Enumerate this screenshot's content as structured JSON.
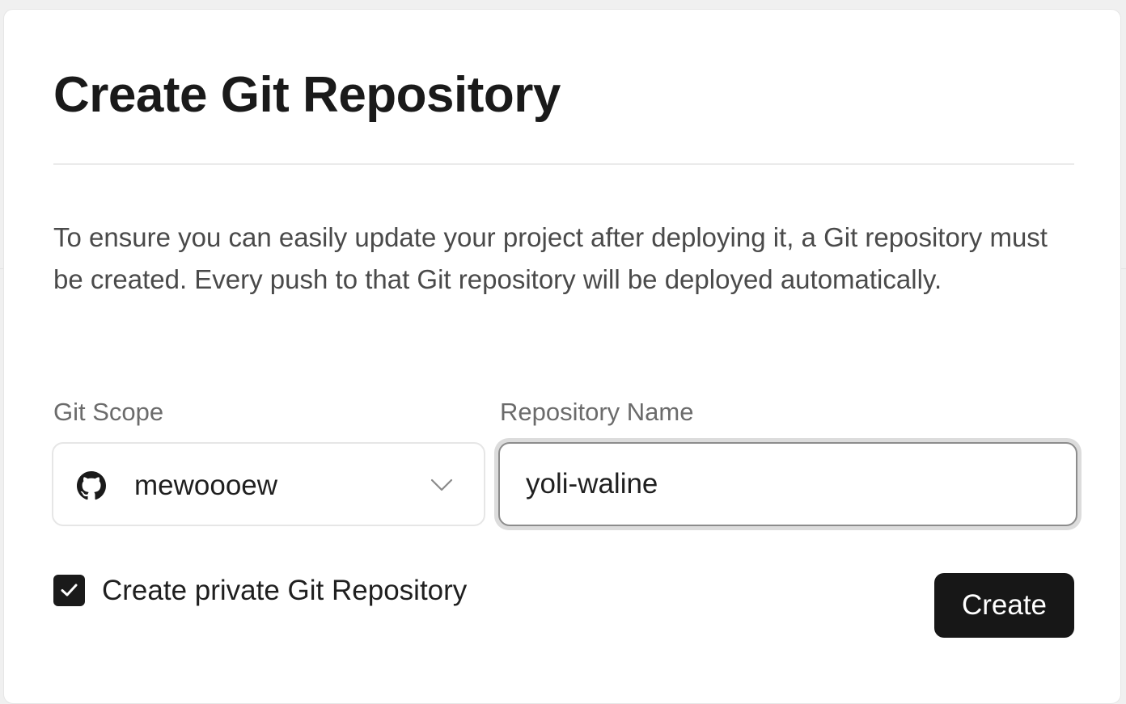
{
  "dialog": {
    "title": "Create Git Repository",
    "description": "To ensure you can easily update your project after deploying it, a Git repository must be created. Every push to that Git repository will be deployed automatically."
  },
  "git_scope": {
    "label": "Git Scope",
    "selected_value": "mewoooew",
    "provider_icon": "github-icon",
    "dropdown_icon": "chevron-down-icon"
  },
  "repository_name": {
    "label": "Repository Name",
    "value": "yoli-waline",
    "focused": true
  },
  "private_option": {
    "label": "Create private Git Repository",
    "checked": true,
    "icon": "checkmark-icon"
  },
  "actions": {
    "create_label": "Create"
  },
  "colors": {
    "primary_button": "#171717",
    "checkbox_fill": "#1a1a1a",
    "text_primary": "#1a1a1a",
    "text_secondary": "#4a4a4a",
    "focus_ring": "#dcdcdc"
  }
}
